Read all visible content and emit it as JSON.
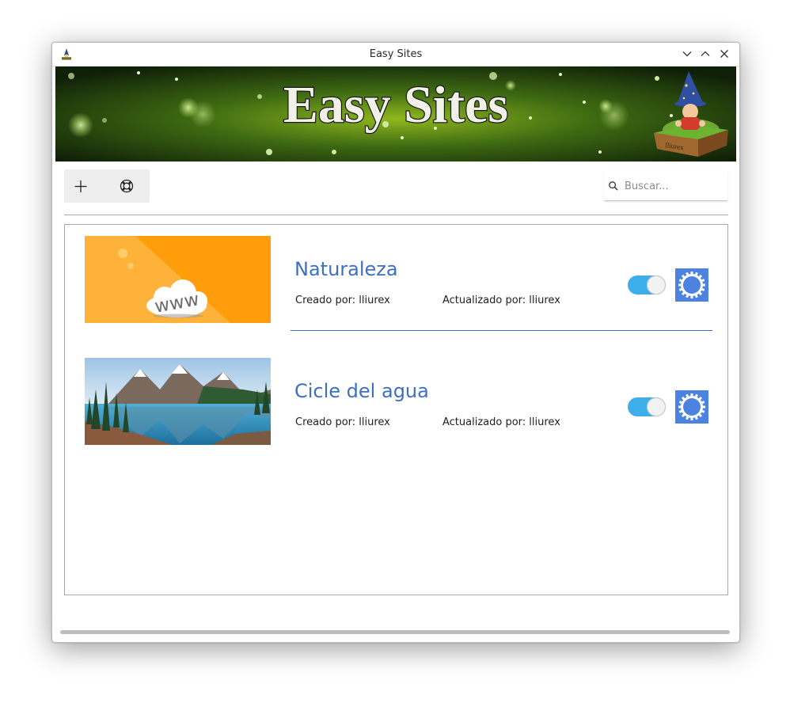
{
  "window": {
    "title": "Easy Sites",
    "controls": [
      "minimize-icon",
      "maximize-icon",
      "close-icon"
    ]
  },
  "banner": {
    "title": "Easy Sites",
    "box_label": "lliurex"
  },
  "toolbar": {
    "add_icon": "plus-icon",
    "help_icon": "lifebuoy-icon"
  },
  "search": {
    "placeholder": "Buscar...",
    "value": ""
  },
  "sites": [
    {
      "name": "Naturaleza",
      "thumbnail": "www-cloud-orange",
      "thumb_text": "www",
      "created": "Creado por: lliurex",
      "updated": "Actualizado por: lliurex",
      "published": true
    },
    {
      "name": "Cicle del agua",
      "thumbnail": "mountain-lake",
      "created": "Creado por: lliurex",
      "updated": "Actualizado por: lliurex",
      "published": true
    }
  ],
  "colors": {
    "accent": "#3daee9",
    "link_blue": "#3f6fc1",
    "edit_button": "#4c82e0",
    "thumb_orange": "#ff9d0a"
  }
}
